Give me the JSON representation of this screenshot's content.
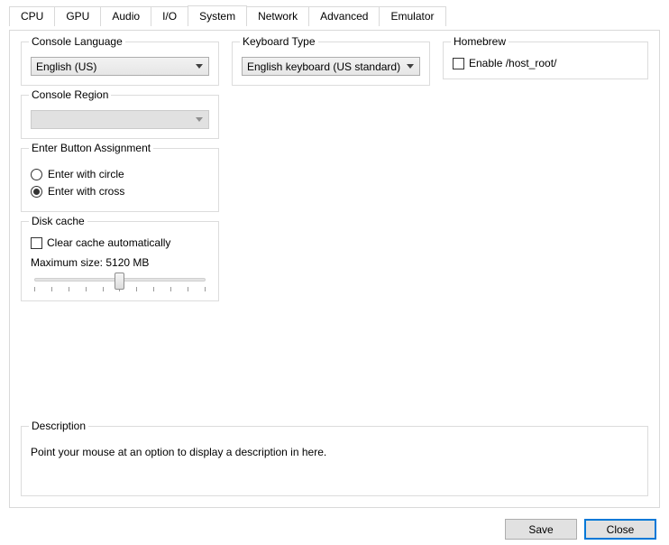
{
  "tabs": {
    "cpu": "CPU",
    "gpu": "GPU",
    "audio": "Audio",
    "io": "I/O",
    "system": "System",
    "network": "Network",
    "advanced": "Advanced",
    "emulator": "Emulator",
    "active": "system"
  },
  "consoleLanguage": {
    "title": "Console Language",
    "value": "English (US)"
  },
  "consoleRegion": {
    "title": "Console Region",
    "value": ""
  },
  "enterButton": {
    "title": "Enter Button Assignment",
    "optionCircle": "Enter with circle",
    "optionCross": "Enter with cross",
    "selected": "cross"
  },
  "diskCache": {
    "title": "Disk cache",
    "clearAuto": "Clear cache automatically",
    "clearAutoChecked": false,
    "maxSizeLabel": "Maximum size: 5120 MB",
    "sliderPercent": 50
  },
  "keyboardType": {
    "title": "Keyboard Type",
    "value": "English keyboard (US standard)"
  },
  "homebrew": {
    "title": "Homebrew",
    "enableLabel": "Enable /host_root/",
    "enableChecked": false
  },
  "description": {
    "title": "Description",
    "text": "Point your mouse at an option to display a description in here."
  },
  "footer": {
    "save": "Save",
    "close": "Close"
  }
}
